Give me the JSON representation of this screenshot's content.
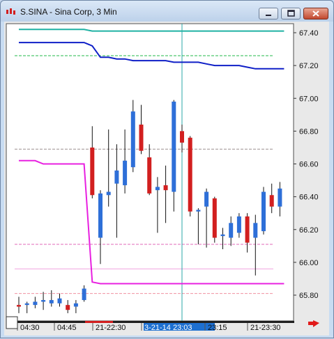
{
  "window": {
    "title": "S.SINA - Sina Corp, 3 Min"
  },
  "colors": {
    "bull_candle": "#2e6fd8",
    "bear_candle": "#d21f1f",
    "wick": "#111111",
    "upper_band": "#1fb1a3",
    "lower_band_top": "#0f1fc7",
    "lower_line": "#e820e0",
    "crosshair": "#2aa7a7",
    "highlight_label_bg": "#1d6fd0"
  },
  "chart_data": {
    "type": "candlestick",
    "title": "S.SINA - Sina Corp, 3 Min",
    "y_axis": {
      "ticks": [
        "67.40",
        "67.20",
        "67.00",
        "66.80",
        "66.60",
        "66.40",
        "66.20",
        "66.00",
        "65.80"
      ],
      "range": [
        65.72,
        67.46
      ]
    },
    "x_axis": {
      "labels": [
        "04:30",
        "04:45",
        "21-22:30",
        "3-21-14 23:03",
        "23:15",
        "21-23:30"
      ],
      "highlighted_label": "3-21-14 23:03"
    },
    "candles": [
      {
        "o": 65.74,
        "c": 65.73,
        "h": 65.79,
        "l": 65.69
      },
      {
        "o": 65.74,
        "c": 65.75,
        "h": 65.76,
        "l": 65.69
      },
      {
        "o": 65.74,
        "c": 65.76,
        "h": 65.79,
        "l": 65.72
      },
      {
        "o": 65.76,
        "c": 65.77,
        "h": 65.82,
        "l": 65.71
      },
      {
        "o": 65.75,
        "c": 65.77,
        "h": 65.83,
        "l": 65.73
      },
      {
        "o": 65.75,
        "c": 65.78,
        "h": 65.81,
        "l": 65.73
      },
      {
        "o": 65.74,
        "c": 65.71,
        "h": 65.77,
        "l": 65.69
      },
      {
        "o": 65.73,
        "c": 65.75,
        "h": 65.77,
        "l": 65.69
      },
      {
        "o": 65.77,
        "c": 65.84,
        "h": 65.86,
        "l": 65.76
      },
      {
        "o": 66.7,
        "c": 66.41,
        "h": 66.83,
        "l": 66.39
      },
      {
        "o": 66.15,
        "c": 66.42,
        "h": 66.44,
        "l": 65.99
      },
      {
        "o": 66.41,
        "c": 66.43,
        "h": 66.81,
        "l": 66.34
      },
      {
        "o": 66.48,
        "c": 66.56,
        "h": 66.72,
        "l": 66.15
      },
      {
        "o": 66.47,
        "c": 66.62,
        "h": 66.81,
        "l": 66.42
      },
      {
        "o": 66.58,
        "c": 66.92,
        "h": 66.99,
        "l": 66.55
      },
      {
        "o": 66.84,
        "c": 66.68,
        "h": 66.96,
        "l": 66.66
      },
      {
        "o": 66.64,
        "c": 66.42,
        "h": 66.72,
        "l": 66.41
      },
      {
        "o": 66.44,
        "c": 66.46,
        "h": 66.52,
        "l": 66.18
      },
      {
        "o": 66.47,
        "c": 66.44,
        "h": 66.59,
        "l": 66.24
      },
      {
        "o": 66.43,
        "c": 66.98,
        "h": 66.99,
        "l": 66.31
      },
      {
        "o": 66.8,
        "c": 66.73,
        "h": 66.84,
        "l": 66.67
      },
      {
        "o": 66.76,
        "c": 66.31,
        "h": 66.77,
        "l": 66.28
      },
      {
        "o": 66.31,
        "c": 66.32,
        "h": 66.33,
        "l": 66.11
      },
      {
        "o": 66.34,
        "c": 66.43,
        "h": 66.45,
        "l": 66.09
      },
      {
        "o": 66.39,
        "c": 66.15,
        "h": 66.4,
        "l": 66.12
      },
      {
        "o": 66.16,
        "c": 66.17,
        "h": 66.21,
        "l": 66.08
      },
      {
        "o": 66.15,
        "c": 66.24,
        "h": 66.28,
        "l": 66.1
      },
      {
        "o": 66.18,
        "c": 66.28,
        "h": 66.3,
        "l": 66.15
      },
      {
        "o": 66.28,
        "c": 66.12,
        "h": 66.3,
        "l": 66.06
      },
      {
        "o": 66.15,
        "c": 66.24,
        "h": 66.29,
        "l": 65.92
      },
      {
        "o": 66.19,
        "c": 66.43,
        "h": 66.46,
        "l": 66.17
      },
      {
        "o": 66.41,
        "c": 66.34,
        "h": 66.48,
        "l": 66.3
      },
      {
        "o": 66.34,
        "c": 66.45,
        "h": 66.49,
        "l": 66.28
      }
    ],
    "series": [
      {
        "values": [
          67.42,
          67.42,
          67.42,
          67.42,
          67.42,
          67.42,
          67.42,
          67.42,
          67.42,
          67.41,
          67.41,
          67.41,
          67.41,
          67.41,
          67.41,
          67.41,
          67.41,
          67.41,
          67.41,
          67.41,
          67.41,
          67.41,
          67.41,
          67.41,
          67.41,
          67.41,
          67.41,
          67.41,
          67.41,
          67.41,
          67.41,
          67.41,
          67.41
        ]
      },
      {
        "values": [
          67.34,
          67.34,
          67.34,
          67.34,
          67.34,
          67.34,
          67.34,
          67.34,
          67.34,
          67.32,
          67.25,
          67.25,
          67.24,
          67.24,
          67.23,
          67.23,
          67.23,
          67.23,
          67.23,
          67.22,
          67.22,
          67.22,
          67.22,
          67.21,
          67.2,
          67.2,
          67.2,
          67.2,
          67.19,
          67.18,
          67.18,
          67.18,
          67.18
        ]
      },
      {
        "values": [
          66.62,
          66.62,
          66.62,
          66.6,
          66.6,
          66.6,
          66.6,
          66.6,
          66.6,
          65.88,
          65.87,
          65.87,
          65.87,
          65.87,
          65.87,
          65.87,
          65.87,
          65.87,
          65.87,
          65.87,
          65.87,
          65.87,
          65.87,
          65.87,
          65.87,
          65.87,
          65.87,
          65.87,
          65.87,
          65.87,
          65.87,
          65.87,
          65.87
        ]
      }
    ],
    "reference_lines": [
      {
        "value": 67.26,
        "color": "#22b84a",
        "style": "dashed"
      },
      {
        "value": 66.69,
        "color": "#9c8f8f",
        "style": "dashed"
      },
      {
        "value": 66.11,
        "color": "#e06ab8",
        "style": "dashed"
      },
      {
        "value": 65.96,
        "color": "#f0a2df",
        "style": "solid"
      },
      {
        "value": 65.81,
        "color": "#f090a0",
        "style": "dashed"
      }
    ],
    "crosshair_candle_index": 20
  }
}
